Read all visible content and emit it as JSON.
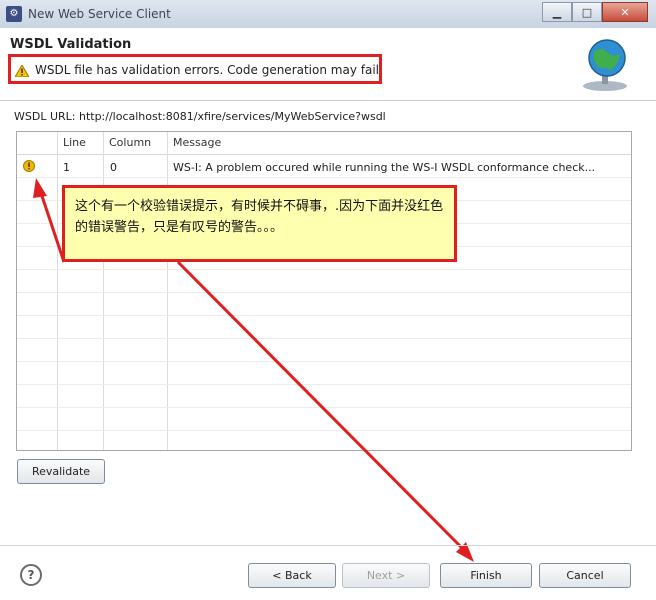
{
  "window": {
    "title": "New Web Service Client",
    "minimize_icon": "minimize-icon",
    "maximize_icon": "maximize-icon",
    "close_icon": "close-icon"
  },
  "header": {
    "title": "WSDL Validation",
    "warning": "WSDL file has validation errors. Code generation may fail",
    "warning_icon": "warning-triangle-icon",
    "banner_icon": "globe-icon"
  },
  "url": {
    "label": "WSDL URL: http://localhost:8081/xfire/services/MyWebService?wsdl"
  },
  "table": {
    "columns": [
      "Line",
      "Column",
      "Message"
    ],
    "rows": [
      {
        "icon": "warning-lock-icon",
        "line": "1",
        "column": "0",
        "message": "WS-I: A problem occured while running the WS-I WSDL conformance check..."
      }
    ]
  },
  "callout": {
    "text": "这个有一个校验错误提示，有时候并不碍事，.因为下面并没红色的错误警告，只是有叹号的警告。。。"
  },
  "buttons": {
    "revalidate": "Revalidate",
    "back": "< Back",
    "next": "Next >",
    "finish": "Finish",
    "cancel": "Cancel",
    "help": "?"
  },
  "colors": {
    "annotation_red": "#e02020",
    "callout_fill": "#ffffb0",
    "warning_yellow": "#f5c400"
  }
}
